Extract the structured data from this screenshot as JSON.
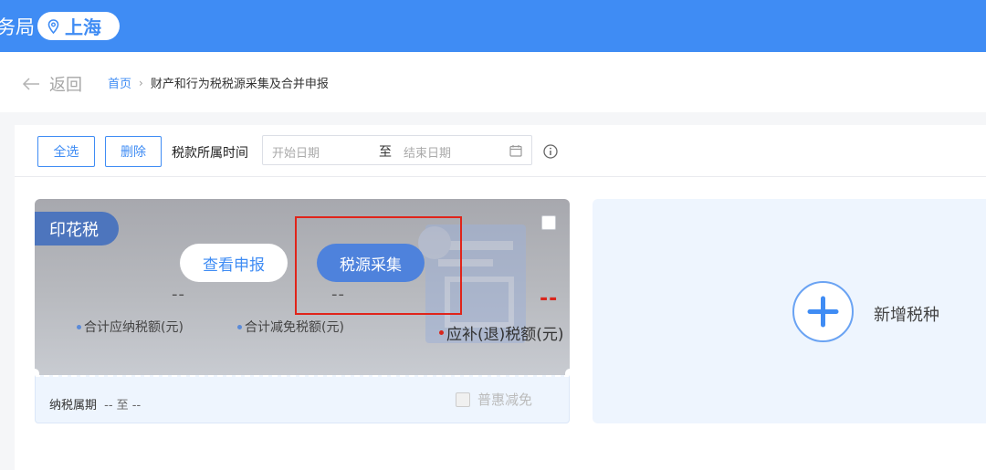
{
  "header": {
    "title": "务局",
    "location": "上海",
    "icon": "location-pin-icon",
    "color": "#3f8cf4"
  },
  "breadcrumb": {
    "back_label": "返回",
    "home": "首页",
    "separator": "›",
    "current": "财产和行为税税源采集及合并申报"
  },
  "toolbar": {
    "select_all": "全选",
    "delete": "删除",
    "period_label": "税款所属时间",
    "start_placeholder": "开始日期",
    "to": "至",
    "end_placeholder": "结束日期"
  },
  "tax_card": {
    "badge": "印花税",
    "view_button": "查看申报",
    "collect_button": "税源采集",
    "total_payable_value": "--",
    "total_payable_label": "合计应纳税额(元)",
    "total_relief_value": "--",
    "total_relief_label": "合计减免税额(元)",
    "refund_value": "--",
    "refund_label": "应补(退)税额(元)",
    "period_label": "纳税属期",
    "period_value": "-- 至 --",
    "perk_label": "普惠减免",
    "highlight_color": "#e0241a"
  },
  "add_card": {
    "label": "新增税种",
    "icon": "plus-icon"
  }
}
